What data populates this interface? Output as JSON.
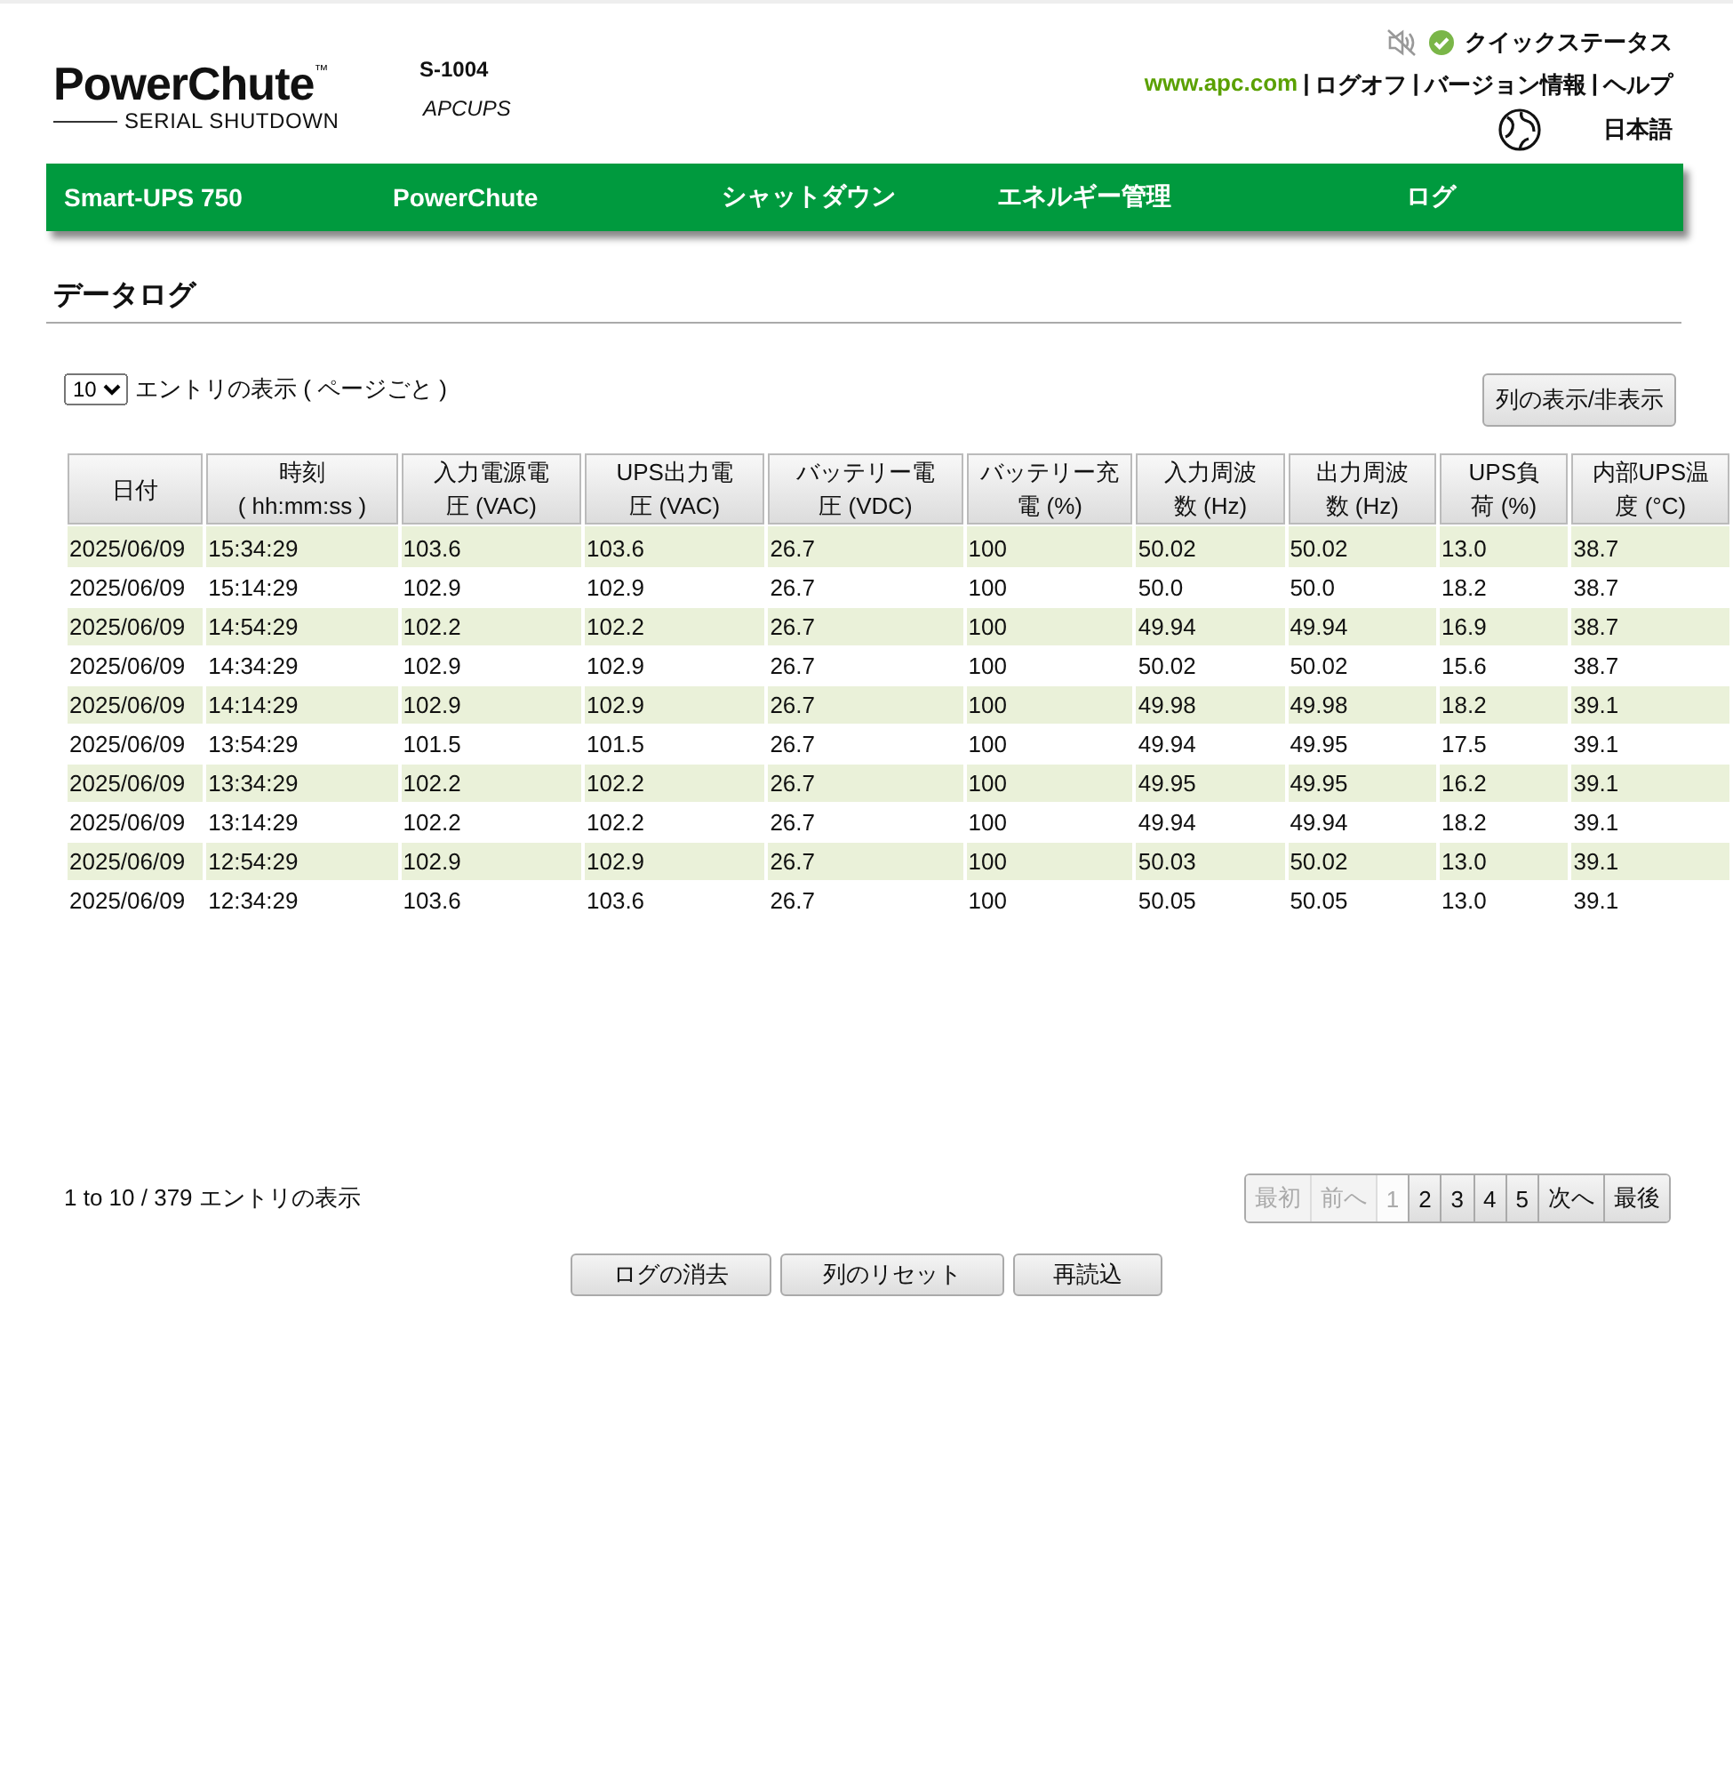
{
  "header": {
    "logo_title": "PowerChute$^{™}$",
    "logo_subtitle": "SERIAL SHUTDOWN",
    "device_model": "S-1004",
    "device_name": "APCUPS",
    "quick_status": "クイックステータス",
    "links": [
      "www.apc.com",
      "ログオフ",
      "バージョン情報",
      "ヘルプ"
    ],
    "link_separator": "|",
    "language": "日本語"
  },
  "nav": [
    "Smart-UPS 750",
    "PowerChute",
    "シャットダウン",
    "エネルギー管理",
    "ログ"
  ],
  "page_title": "データログ",
  "page_size": {
    "value": "10",
    "label": "エントリの表示 ( ページごと )"
  },
  "column_toggle_button": "列の表示/非表示",
  "table": {
    "columns": [
      {
        "lines": [
          "日付"
        ]
      },
      {
        "lines": [
          "時刻",
          "( hh:mm:ss )"
        ]
      },
      {
        "lines": [
          "入力電源電",
          "圧 (VAC)"
        ]
      },
      {
        "lines": [
          "UPS出力電",
          "圧 (VAC)"
        ]
      },
      {
        "lines": [
          "バッテリー電",
          "圧 (VDC)"
        ]
      },
      {
        "lines": [
          "バッテリー充",
          "電 (%)"
        ]
      },
      {
        "lines": [
          "入力周波",
          "数 (Hz)"
        ]
      },
      {
        "lines": [
          "出力周波",
          "数 (Hz)"
        ]
      },
      {
        "lines": [
          "UPS負",
          "荷 (%)"
        ]
      },
      {
        "lines": [
          "内部UPS温",
          "度 (°C)"
        ]
      }
    ],
    "rows": [
      [
        "2025/06/09",
        "15:34:29",
        "103.6",
        "103.6",
        "26.7",
        "100",
        "50.02",
        "50.02",
        "13.0",
        "38.7"
      ],
      [
        "2025/06/09",
        "15:14:29",
        "102.9",
        "102.9",
        "26.7",
        "100",
        "50.0",
        "50.0",
        "18.2",
        "38.7"
      ],
      [
        "2025/06/09",
        "14:54:29",
        "102.2",
        "102.2",
        "26.7",
        "100",
        "49.94",
        "49.94",
        "16.9",
        "38.7"
      ],
      [
        "2025/06/09",
        "14:34:29",
        "102.9",
        "102.9",
        "26.7",
        "100",
        "50.02",
        "50.02",
        "15.6",
        "38.7"
      ],
      [
        "2025/06/09",
        "14:14:29",
        "102.9",
        "102.9",
        "26.7",
        "100",
        "49.98",
        "49.98",
        "18.2",
        "39.1"
      ],
      [
        "2025/06/09",
        "13:54:29",
        "101.5",
        "101.5",
        "26.7",
        "100",
        "49.94",
        "49.95",
        "17.5",
        "39.1"
      ],
      [
        "2025/06/09",
        "13:34:29",
        "102.2",
        "102.2",
        "26.7",
        "100",
        "49.95",
        "49.95",
        "16.2",
        "39.1"
      ],
      [
        "2025/06/09",
        "13:14:29",
        "102.2",
        "102.2",
        "26.7",
        "100",
        "49.94",
        "49.94",
        "18.2",
        "39.1"
      ],
      [
        "2025/06/09",
        "12:54:29",
        "102.9",
        "102.9",
        "26.7",
        "100",
        "50.03",
        "50.02",
        "13.0",
        "39.1"
      ],
      [
        "2025/06/09",
        "12:34:29",
        "103.6",
        "103.6",
        "26.7",
        "100",
        "50.05",
        "50.05",
        "13.0",
        "39.1"
      ]
    ]
  },
  "summary": "1 to 10 / 379 エントリの表示",
  "pagination": [
    {
      "label": "最初",
      "disabled": true,
      "selected": false
    },
    {
      "label": "前へ",
      "disabled": true,
      "selected": false
    },
    {
      "label": "1",
      "disabled": false,
      "selected": true
    },
    {
      "label": "2",
      "disabled": false,
      "selected": false
    },
    {
      "label": "3",
      "disabled": false,
      "selected": false
    },
    {
      "label": "4",
      "disabled": false,
      "selected": false
    },
    {
      "label": "5",
      "disabled": false,
      "selected": false
    },
    {
      "label": "次へ",
      "disabled": false,
      "selected": false
    },
    {
      "label": "最後",
      "disabled": false,
      "selected": false
    }
  ],
  "buttons": [
    "ログの消去",
    "列のリセット",
    "再読込"
  ]
}
